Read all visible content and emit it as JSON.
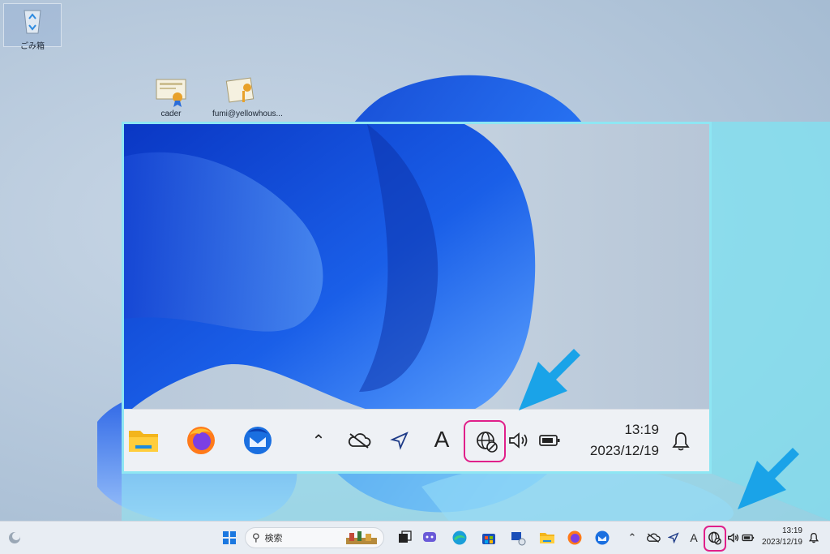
{
  "desktop": {
    "icons": [
      {
        "label": "ごみ箱"
      },
      {
        "label": "cader"
      },
      {
        "label": "fumi@yellowhous..."
      }
    ]
  },
  "zoom": {
    "clock": {
      "time": "13:19",
      "date": "2023/12/19"
    },
    "ime_label": "A"
  },
  "taskbar": {
    "search_placeholder": "検索",
    "ime_label": "A",
    "clock": {
      "time": "13:19",
      "date": "2023/12/19"
    }
  },
  "colors": {
    "highlight_ring": "#e0208a",
    "arrow": "#1aa3e8",
    "callout_border": "#8ee6f3"
  }
}
